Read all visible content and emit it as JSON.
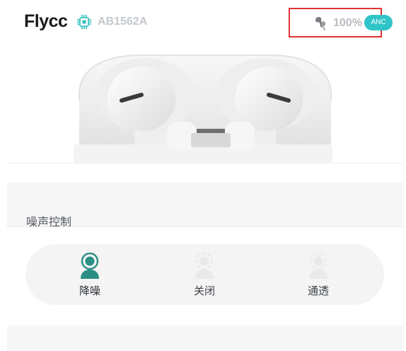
{
  "header": {
    "brand": "Flycc",
    "model": "AB1562A",
    "battery": "100%",
    "anc_badge": "ANC"
  },
  "noise_control": {
    "title": "噪声控制",
    "modes": [
      {
        "label": "降噪",
        "active": true
      },
      {
        "label": "关闭",
        "active": false
      },
      {
        "label": "通透",
        "active": false
      }
    ]
  },
  "colors": {
    "accent": "#2fc4c7",
    "active_icon": "#2a8e84",
    "inactive_icon": "#e7e9eb",
    "highlight_box": "#e03131"
  },
  "icons": {
    "chip": "chip-icon",
    "earbud": "earbud-icon",
    "noise_cancel": "noise-cancel-icon",
    "off": "anc-off-icon",
    "transparency": "transparency-icon"
  }
}
